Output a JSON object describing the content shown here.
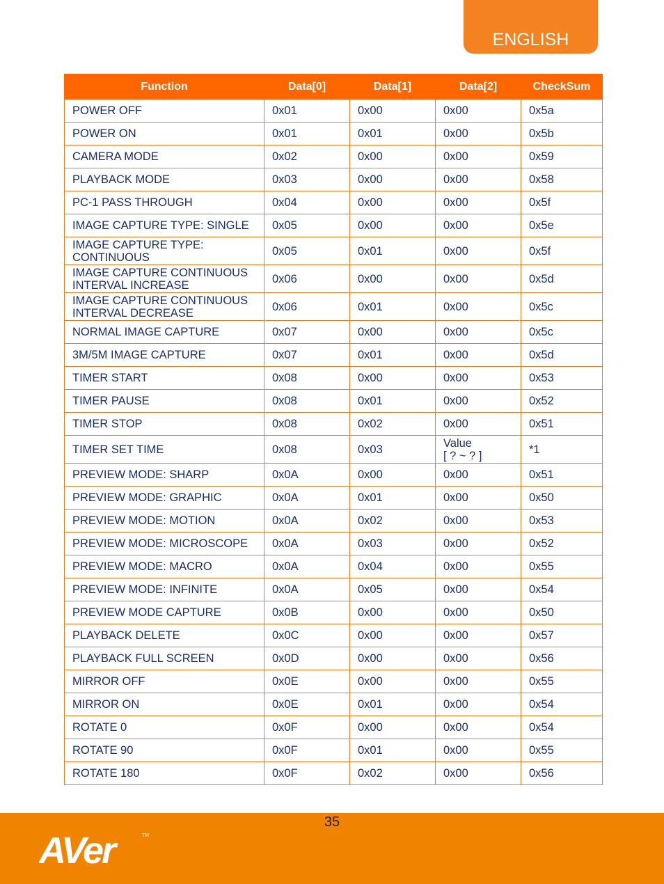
{
  "header": {
    "language_tab": "ENGLISH"
  },
  "table": {
    "columns": [
      "Function",
      "Data[0]",
      "Data[1]",
      "Data[2]",
      "CheckSum"
    ],
    "rows": [
      [
        "POWER OFF",
        "0x01",
        "0x00",
        "0x00",
        "0x5a"
      ],
      [
        "POWER ON",
        "0x01",
        "0x01",
        "0x00",
        "0x5b"
      ],
      [
        "CAMERA MODE",
        "0x02",
        "0x00",
        "0x00",
        "0x59"
      ],
      [
        "PLAYBACK MODE",
        "0x03",
        "0x00",
        "0x00",
        "0x58"
      ],
      [
        "PC-1 PASS THROUGH",
        "0x04",
        "0x00",
        "0x00",
        "0x5f"
      ],
      [
        "IMAGE CAPTURE TYPE: SINGLE",
        "0x05",
        "0x00",
        "0x00",
        "0x5e"
      ],
      [
        "IMAGE CAPTURE TYPE: CONTINUOUS",
        "0x05",
        "0x01",
        "0x00",
        "0x5f"
      ],
      [
        "IMAGE CAPTURE CONTINUOUS INTERVAL INCREASE",
        "0x06",
        "0x00",
        "0x00",
        "0x5d"
      ],
      [
        "IMAGE CAPTURE CONTINUOUS INTERVAL DECREASE",
        "0x06",
        "0x01",
        "0x00",
        "0x5c"
      ],
      [
        "NORMAL IMAGE CAPTURE",
        "0x07",
        "0x00",
        "0x00",
        "0x5c"
      ],
      [
        "3M/5M IMAGE CAPTURE",
        "0x07",
        "0x01",
        "0x00",
        "0x5d"
      ],
      [
        "TIMER START",
        "0x08",
        "0x00",
        "0x00",
        "0x53"
      ],
      [
        "TIMER PAUSE",
        "0x08",
        "0x01",
        "0x00",
        "0x52"
      ],
      [
        "TIMER STOP",
        "0x08",
        "0x02",
        "0x00",
        "0x51"
      ],
      [
        "TIMER SET TIME",
        "0x08",
        "0x03",
        "Value [ ? ~ ? ]",
        "*1"
      ],
      [
        "PREVIEW MODE: SHARP",
        "0x0A",
        "0x00",
        "0x00",
        "0x51"
      ],
      [
        "PREVIEW MODE: GRAPHIC",
        "0x0A",
        "0x01",
        "0x00",
        "0x50"
      ],
      [
        "PREVIEW MODE: MOTION",
        "0x0A",
        "0x02",
        "0x00",
        "0x53"
      ],
      [
        "PREVIEW MODE: MICROSCOPE",
        "0x0A",
        "0x03",
        "0x00",
        "0x52"
      ],
      [
        "PREVIEW MODE: MACRO",
        "0x0A",
        "0x04",
        "0x00",
        "0x55"
      ],
      [
        "PREVIEW MODE: INFINITE",
        "0x0A",
        "0x05",
        "0x00",
        "0x54"
      ],
      [
        "PREVIEW MODE CAPTURE",
        "0x0B",
        "0x00",
        "0x00",
        "0x50"
      ],
      [
        "PLAYBACK DELETE",
        "0x0C",
        "0x00",
        "0x00",
        "0x57"
      ],
      [
        "PLAYBACK FULL SCREEN",
        "0x0D",
        "0x00",
        "0x00",
        "0x56"
      ],
      [
        "MIRROR OFF",
        "0x0E",
        "0x00",
        "0x00",
        "0x55"
      ],
      [
        "MIRROR ON",
        "0x0E",
        "0x01",
        "0x00",
        "0x54"
      ],
      [
        "ROTATE 0",
        "0x0F",
        "0x00",
        "0x00",
        "0x54"
      ],
      [
        "ROTATE 90",
        "0x0F",
        "0x01",
        "0x00",
        "0x55"
      ],
      [
        "ROTATE 180",
        "0x0F",
        "0x02",
        "0x00",
        "0x56"
      ]
    ]
  },
  "footer": {
    "page_number": "35",
    "logo_text": "AVer",
    "trademark": "TM"
  },
  "colors": {
    "header_orange": "#ff6600",
    "tab_orange": "#f58220",
    "footer_orange": "#f08300",
    "text_navy": "#1a2d6b"
  }
}
